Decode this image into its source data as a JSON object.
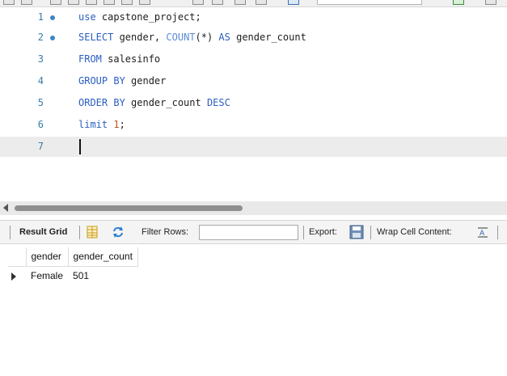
{
  "editor": {
    "lines": [
      {
        "num": "1",
        "bullet": true
      },
      {
        "num": "2",
        "bullet": true
      },
      {
        "num": "3",
        "bullet": false
      },
      {
        "num": "4",
        "bullet": false
      },
      {
        "num": "5",
        "bullet": false
      },
      {
        "num": "6",
        "bullet": false
      },
      {
        "num": "7",
        "bullet": false
      }
    ],
    "tokens": {
      "l1_kw": "use",
      "l1_rest": " capstone_project;",
      "l2_kw1": "SELECT",
      "l2_a": " gender, ",
      "l2_fn": "COUNT",
      "l2_b": "(*) ",
      "l2_kw2": "AS",
      "l2_c": " gender_count",
      "l3_kw": "FROM",
      "l3_rest": " salesinfo",
      "l4_kw": "GROUP BY",
      "l4_rest": " gender",
      "l5_kw1": "ORDER BY",
      "l5_a": " gender_count ",
      "l5_kw2": "DESC",
      "l6_kw": "limit",
      "l6_sp": " ",
      "l6_num": "1",
      "l6_end": ";"
    },
    "current_line": "7"
  },
  "result_toolbar": {
    "result_grid": "Result Grid",
    "filter_rows": "Filter Rows:",
    "export": "Export:",
    "wrap_cell": "Wrap Cell Content:"
  },
  "grid": {
    "columns": [
      "gender",
      "gender_count"
    ],
    "rows": [
      [
        "Female",
        "501"
      ]
    ]
  },
  "icons": {
    "grid_icon": "grid-form-icon",
    "filter_icon": "refresh-arrows-icon",
    "export_icon": "save-disk-icon",
    "wrap_icon": "wrap-text-icon"
  },
  "colors": {
    "keyword": "#2a5ec1",
    "function": "#5b8bd6",
    "number": "#b8541e",
    "line_number": "#3a7ca8"
  }
}
